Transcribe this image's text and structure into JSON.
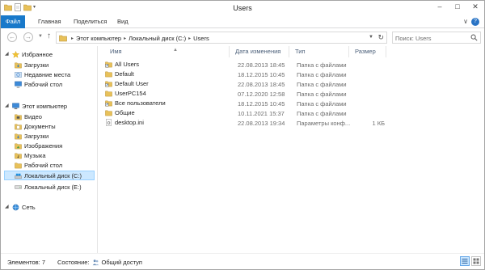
{
  "window": {
    "title": "Users"
  },
  "ribbon": {
    "tabs": [
      "Файл",
      "Главная",
      "Поделиться",
      "Вид"
    ]
  },
  "address": {
    "crumbs": [
      "Этот компьютер",
      "Локальный диск (C:)",
      "Users"
    ],
    "search_placeholder": "Поиск: Users"
  },
  "nav": {
    "favorites": {
      "label": "Избранное",
      "items": [
        "Загрузки",
        "Недавние места",
        "Рабочий стол"
      ]
    },
    "computer": {
      "label": "Этот компьютер",
      "items": [
        "Видео",
        "Документы",
        "Загрузки",
        "Изображения",
        "Музыка",
        "Рабочий стол",
        "Локальный диск (C:)",
        "Локальный диск (E:)"
      ]
    },
    "network": {
      "label": "Сеть"
    }
  },
  "columns": {
    "name": "Имя",
    "date": "Дата изменения",
    "type": "Тип",
    "size": "Размер"
  },
  "files": [
    {
      "name": "All Users",
      "date": "22.08.2013 18:45",
      "type": "Папка с файлами",
      "size": "",
      "icon": "folder-shortcut-icon"
    },
    {
      "name": "Default",
      "date": "18.12.2015 10:45",
      "type": "Папка с файлами",
      "size": "",
      "icon": "folder-icon"
    },
    {
      "name": "Default User",
      "date": "22.08.2013 18:45",
      "type": "Папка с файлами",
      "size": "",
      "icon": "folder-shortcut-icon"
    },
    {
      "name": "UserPC154",
      "date": "07.12.2020 12:58",
      "type": "Папка с файлами",
      "size": "",
      "icon": "folder-icon"
    },
    {
      "name": "Все пользователи",
      "date": "18.12.2015 10:45",
      "type": "Папка с файлами",
      "size": "",
      "icon": "folder-shortcut-icon"
    },
    {
      "name": "Общие",
      "date": "10.11.2021 15:37",
      "type": "Папка с файлами",
      "size": "",
      "icon": "folder-icon"
    },
    {
      "name": "desktop.ini",
      "date": "22.08.2013 19:34",
      "type": "Параметры конф...",
      "size": "1 КБ",
      "icon": "settings-file-icon"
    }
  ],
  "status": {
    "items": "Элементов: 7",
    "state_label": "Состояние:",
    "state_value": "Общий доступ"
  },
  "colors": {
    "accent": "#1979ca",
    "folder": "#e8c15a",
    "selection": "#cce8ff"
  }
}
